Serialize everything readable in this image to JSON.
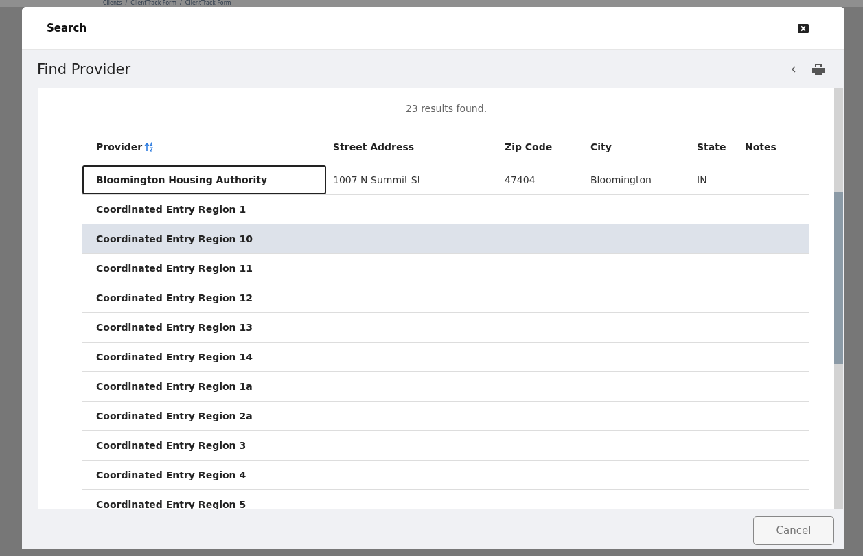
{
  "background": {
    "breadcrumb": "Clients  /  ClientTrack Form  /  ClientTrack Form"
  },
  "dialog": {
    "title": "Search",
    "heading": "Find Provider"
  },
  "results": "23 results found.",
  "table": {
    "columns": [
      {
        "label": "Provider",
        "sorted": true
      },
      {
        "label": "Street Address",
        "sorted": false
      },
      {
        "label": "Zip Code",
        "sorted": false
      },
      {
        "label": "City",
        "sorted": false
      },
      {
        "label": "State",
        "sorted": false
      },
      {
        "label": "Notes",
        "sorted": false
      }
    ],
    "rows": [
      {
        "provider": "Bloomington Housing Authority",
        "street": "1007 N Summit St",
        "zip": "47404",
        "city": "Bloomington",
        "state": "IN",
        "focused": true,
        "highlighted": false
      },
      {
        "provider": "Coordinated Entry Region 1",
        "focused": false,
        "highlighted": false
      },
      {
        "provider": "Coordinated Entry Region 10",
        "focused": false,
        "highlighted": true
      },
      {
        "provider": "Coordinated Entry Region 11",
        "focused": false,
        "highlighted": false
      },
      {
        "provider": "Coordinated Entry Region 12",
        "focused": false,
        "highlighted": false
      },
      {
        "provider": "Coordinated Entry Region 13",
        "focused": false,
        "highlighted": false
      },
      {
        "provider": "Coordinated Entry Region 14",
        "focused": false,
        "highlighted": false
      },
      {
        "provider": "Coordinated Entry Region 1a",
        "focused": false,
        "highlighted": false
      },
      {
        "provider": "Coordinated Entry Region 2a",
        "focused": false,
        "highlighted": false
      },
      {
        "provider": "Coordinated Entry Region 3",
        "focused": false,
        "highlighted": false
      },
      {
        "provider": "Coordinated Entry Region 4",
        "focused": false,
        "highlighted": false
      },
      {
        "provider": "Coordinated Entry Region 5",
        "focused": false,
        "highlighted": false
      }
    ]
  },
  "buttons": [
    "Cancel"
  ]
}
